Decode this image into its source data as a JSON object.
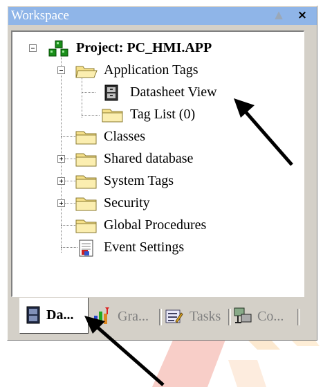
{
  "workspace": {
    "title": "Workspace",
    "pin_glyph": "▲",
    "close_glyph": "×"
  },
  "tree": {
    "project": {
      "label": "Project: PC_HMI.APP",
      "icon": "project-icon"
    },
    "items": [
      {
        "label": "Application Tags",
        "icon": "folder-open-icon",
        "expander": "minus"
      },
      {
        "label": "Datasheet View",
        "icon": "datasheet-icon"
      },
      {
        "label": "Tag List (0)",
        "icon": "folder-icon"
      },
      {
        "label": "Classes",
        "icon": "folder-icon"
      },
      {
        "label": "Shared database",
        "icon": "folder-icon",
        "expander": "plus"
      },
      {
        "label": "System Tags",
        "icon": "folder-icon",
        "expander": "plus"
      },
      {
        "label": "Security",
        "icon": "folder-icon",
        "expander": "plus"
      },
      {
        "label": "Global Procedures",
        "icon": "folder-icon"
      },
      {
        "label": "Event Settings",
        "icon": "event-settings-icon"
      }
    ]
  },
  "tabs": [
    {
      "label": "Da...",
      "icon": "database-icon",
      "active": true
    },
    {
      "label": "Gra...",
      "icon": "graphics-icon",
      "active": false
    },
    {
      "label": "Tasks",
      "icon": "tasks-icon",
      "active": false
    },
    {
      "label": "Co...",
      "icon": "comm-icon",
      "active": false
    }
  ],
  "colors": {
    "titlebar": "#8fb5e8",
    "panel": "#d4d0c8",
    "folder": "#f5e08a",
    "arrow": "#000000"
  }
}
